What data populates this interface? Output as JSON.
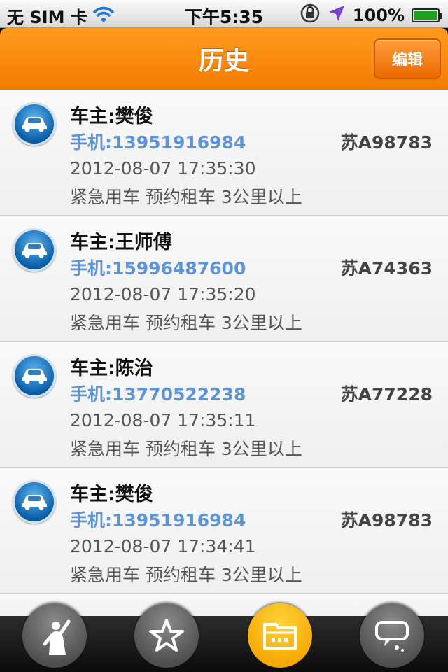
{
  "status_bar": {
    "carrier": "无 SIM 卡",
    "time": "下午5:35",
    "battery": "100%",
    "battery_level": 1.0,
    "icons": [
      "wifi-icon",
      "rotation-lock-icon",
      "location-arrow-icon",
      "battery-icon"
    ]
  },
  "navbar": {
    "title": "历史",
    "edit_label": "编辑",
    "accent_color": "#f58a0c"
  },
  "records": [
    {
      "owner": "车主:樊俊",
      "phone": "手机:13951916984",
      "plate": "苏A98783",
      "time": "2012-08-07 17:35:30",
      "desc": "紧急用车 预约租车 3公里以上"
    },
    {
      "owner": "车主:王师傅",
      "phone": "手机:15996487600",
      "plate": "苏A74363",
      "time": "2012-08-07 17:35:20",
      "desc": "紧急用车 预约租车 3公里以上"
    },
    {
      "owner": "车主:陈治",
      "phone": "手机:13770522238",
      "plate": "苏A77228",
      "time": "2012-08-07 17:35:11",
      "desc": "紧急用车 预约租车 3公里以上"
    },
    {
      "owner": "车主:樊俊",
      "phone": "手机:13951916984",
      "plate": "苏A98783",
      "time": "2012-08-07 17:34:41",
      "desc": "紧急用车 预约租车 3公里以上"
    }
  ],
  "tabbar": {
    "tabs": [
      {
        "icon": "person-waving-icon",
        "active": false
      },
      {
        "icon": "star-icon",
        "active": false
      },
      {
        "icon": "folder-icon",
        "active": true
      },
      {
        "icon": "speech-bubble-icon",
        "active": false
      }
    ],
    "active_color": "#f5a800"
  }
}
